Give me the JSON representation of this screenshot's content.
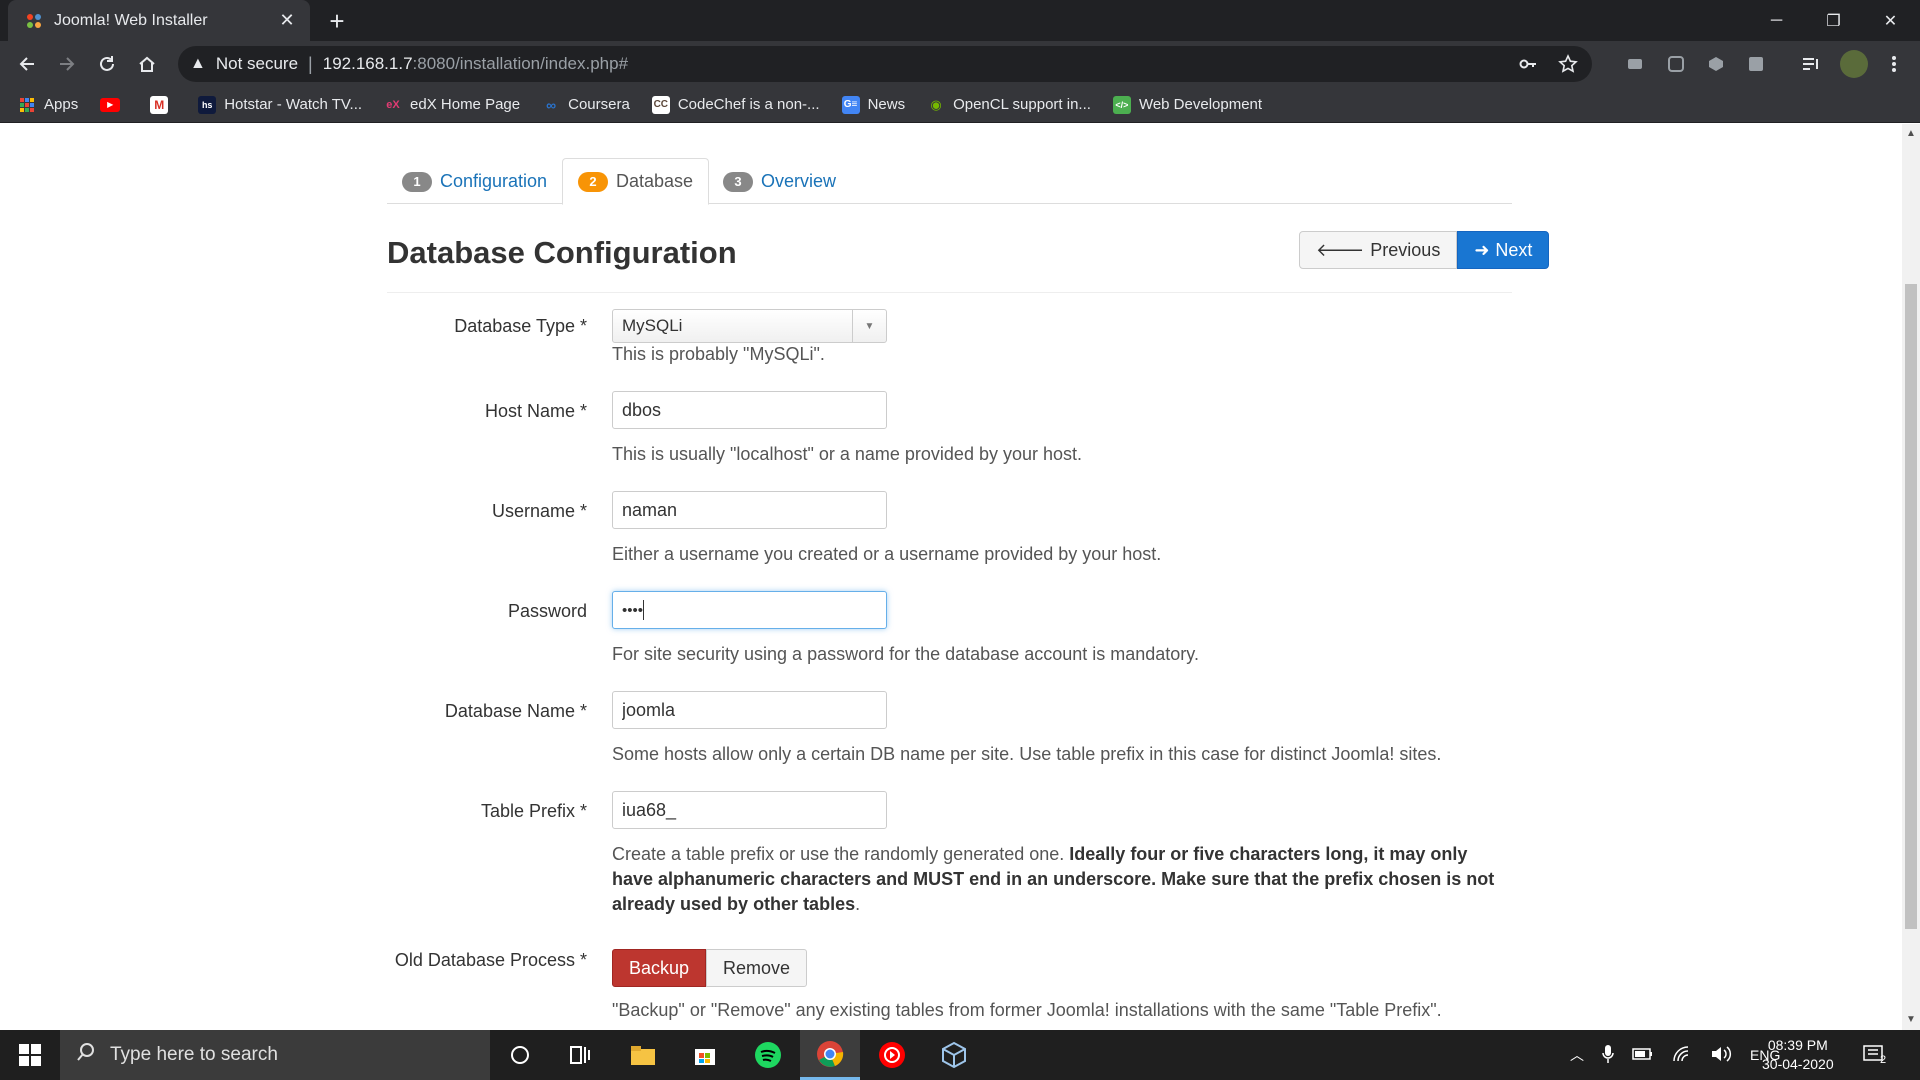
{
  "browser": {
    "tab_title": "Joomla! Web Installer",
    "security_label": "Not secure",
    "url_host": "192.168.1.7",
    "url_path": ":8080/installation/index.php#",
    "bookmarks": [
      {
        "label": "Apps",
        "icon": "apps-grid-icon"
      },
      {
        "label": "",
        "icon": "youtube-icon"
      },
      {
        "label": "",
        "icon": "gmail-icon"
      },
      {
        "label": "Hotstar - Watch TV...",
        "icon": "hotstar-icon"
      },
      {
        "label": "edX Home Page",
        "icon": "edx-icon"
      },
      {
        "label": "Coursera",
        "icon": "coursera-icon"
      },
      {
        "label": "CodeChef is a non-...",
        "icon": "codechef-icon"
      },
      {
        "label": "News",
        "icon": "google-news-icon"
      },
      {
        "label": "OpenCL support in...",
        "icon": "nvidia-icon"
      },
      {
        "label": "Web Development",
        "icon": "webdev-icon"
      }
    ]
  },
  "installer": {
    "tabs": [
      {
        "num": "1",
        "label": "Configuration"
      },
      {
        "num": "2",
        "label": "Database"
      },
      {
        "num": "3",
        "label": "Overview"
      }
    ],
    "heading": "Database Configuration",
    "previous_label": "Previous",
    "next_label": "Next",
    "fields": {
      "db_type": {
        "label": "Database Type *",
        "value": "MySQLi",
        "help": "This is probably \"MySQLi\"."
      },
      "host": {
        "label": "Host Name *",
        "value": "dbos",
        "help": "This is usually \"localhost\" or a name provided by your host."
      },
      "username": {
        "label": "Username *",
        "value": "naman",
        "help": "Either a username you created or a username provided by your host."
      },
      "password": {
        "label": "Password",
        "value": "••••",
        "help": "For site security using a password for the database account is mandatory."
      },
      "db_name": {
        "label": "Database Name *",
        "value": "joomla",
        "help": "Some hosts allow only a certain DB name per site. Use table prefix in this case for distinct Joomla! sites."
      },
      "prefix": {
        "label": "Table Prefix *",
        "value": "iua68_",
        "help_plain": "Create a table prefix or use the randomly generated one. ",
        "help_bold": "Ideally four or five characters long, it may only have alphanumeric characters and MUST end in an underscore. Make sure that the prefix chosen is not already used by other tables",
        "help_end": "."
      },
      "old_db": {
        "label": "Old Database Process *",
        "backup_label": "Backup",
        "remove_label": "Remove",
        "help": "\"Backup\" or \"Remove\" any existing tables from former Joomla! installations with the same \"Table Prefix\"."
      }
    }
  },
  "taskbar": {
    "search_placeholder": "Type here to search",
    "language": "ENG",
    "time": "08:39 PM",
    "date": "30-04-2020",
    "notification_count": "2"
  },
  "colors": {
    "accent_blue": "#1976d2",
    "backup_red": "#bd362f",
    "active_step": "#f89406"
  }
}
